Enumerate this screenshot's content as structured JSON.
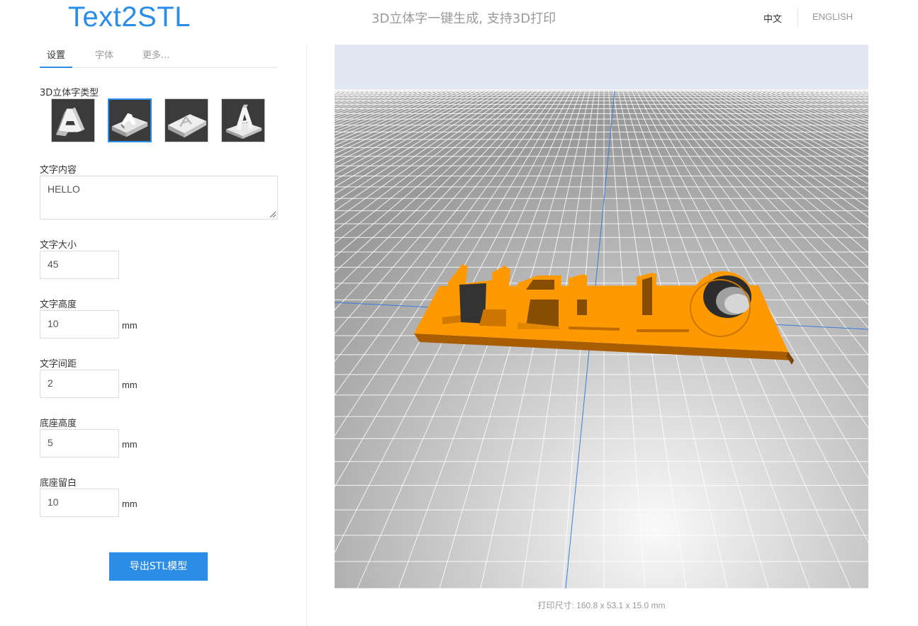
{
  "header": {
    "logo": "Text2STL",
    "tagline": "3D立体字一键生成, 支持3D打印",
    "lang_zh": "中文",
    "lang_en": "ENGLISH"
  },
  "tabs": [
    {
      "label": "设置",
      "active": true
    },
    {
      "label": "字体",
      "active": false
    },
    {
      "label": "更多...",
      "active": false
    }
  ],
  "settings": {
    "type_label": "3D立体字类型",
    "types": [
      "standing-letter",
      "raised-on-base",
      "engraved-in-base",
      "cutout-standing"
    ],
    "selected_type_index": 1,
    "text_label": "文字内容",
    "text_value": "HELLO",
    "size_label": "文字大小",
    "size_value": "45",
    "height_label": "文字高度",
    "height_value": "10",
    "spacing_label": "文字间距",
    "spacing_value": "2",
    "base_height_label": "底座高度",
    "base_height_value": "5",
    "base_margin_label": "底座留白",
    "base_margin_value": "10",
    "unit": "mm",
    "export_label": "导出STL模型"
  },
  "preview": {
    "model_text": "HELLO",
    "model_color": "#ff9900",
    "print_size": "打印尺寸: 160.8 x 53.1 x 15.0 mm"
  },
  "colors": {
    "accent": "#2b8de8",
    "sky": "#e1e7f3",
    "grid": "#ffffff"
  }
}
